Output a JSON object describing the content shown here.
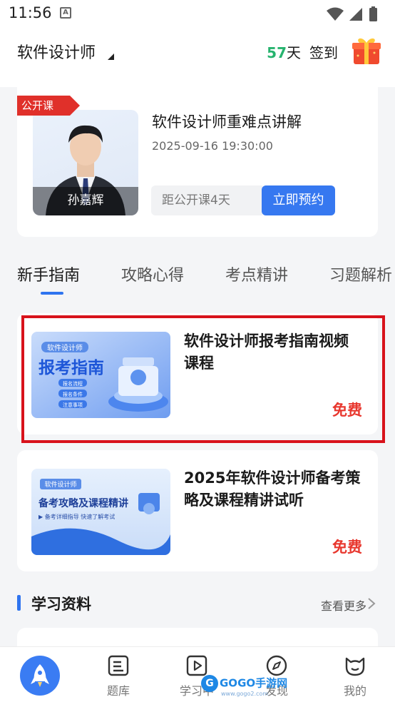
{
  "status_bar": {
    "time": "11:56",
    "notification_icon": "A"
  },
  "header": {
    "course_title": "软件设计师",
    "streak_days": "57",
    "days_unit": "天",
    "checkin_label": "签到"
  },
  "live_class": {
    "tag": "公开课",
    "teacher_name": "孙嘉辉",
    "title": "软件设计师重难点讲解",
    "datetime": "2025-09-16 19:30:00",
    "countdown": "距公开课4天",
    "reserve_label": "立即预约"
  },
  "tabs": [
    {
      "label": "新手指南",
      "active": true
    },
    {
      "label": "攻略心得",
      "active": false
    },
    {
      "label": "考点精讲",
      "active": false
    },
    {
      "label": "习题解析",
      "active": false
    }
  ],
  "videos": [
    {
      "title": "软件设计师报考指南视频课程",
      "price": "免费",
      "thumb": {
        "tag": "软件设计师",
        "headline": "报考指南",
        "items": [
          "报名流程",
          "报名条件",
          "注意事项"
        ]
      }
    },
    {
      "title": "2025年软件设计师备考策略及课程精讲试听",
      "price": "免费",
      "thumb": {
        "tag": "软件设计师",
        "headline": "备考攻略及课程精讲",
        "subline": "▶ 备考详细指导 快速了解考试"
      }
    }
  ],
  "study_section": {
    "title": "学习资料",
    "more_label": "查看更多"
  },
  "bottom_nav": [
    {
      "label": "",
      "icon": "rocket-icon",
      "active": true
    },
    {
      "label": "题库",
      "icon": "question-bank-icon"
    },
    {
      "label": "学习中",
      "icon": "play-icon"
    },
    {
      "label": "发现",
      "icon": "compass-icon"
    },
    {
      "label": "我的",
      "icon": "cat-face-icon"
    }
  ],
  "watermark": {
    "text": "GOGO手游网",
    "sub": "www.gogo2.com"
  },
  "colors": {
    "primary": "#3678f0",
    "accent_red": "#e8372e",
    "streak_green": "#26b36e",
    "tag_red": "#e0302a",
    "highlight": "#d8121b"
  }
}
